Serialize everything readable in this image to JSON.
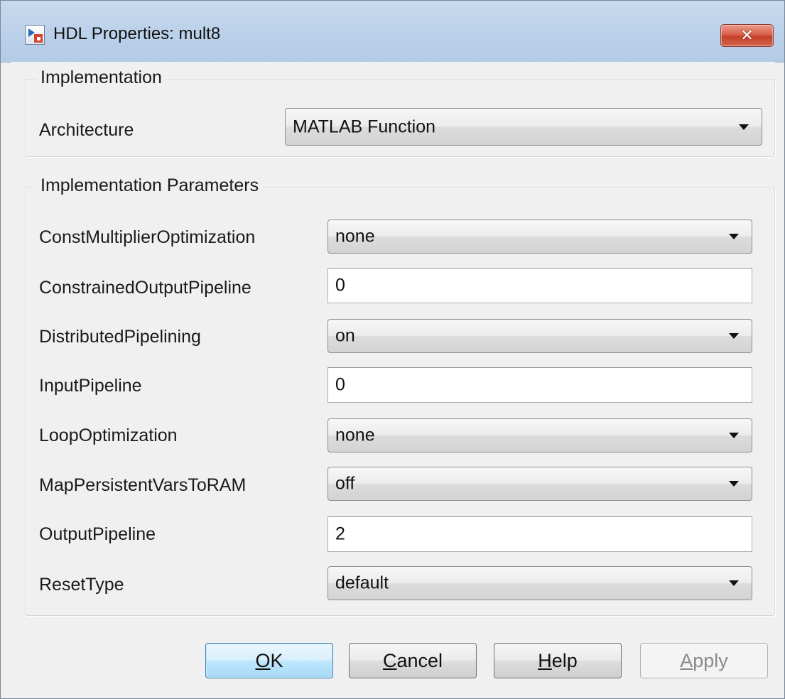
{
  "window": {
    "title": "HDL Properties: mult8",
    "close_label": "✕"
  },
  "implementation": {
    "legend": "Implementation",
    "architecture_label": "Architecture",
    "architecture_value": "MATLAB Function"
  },
  "parameters": {
    "legend": "Implementation Parameters",
    "rows": [
      {
        "label": "ConstMultiplierOptimization",
        "value": "none",
        "kind": "dropdown"
      },
      {
        "label": "ConstrainedOutputPipeline",
        "value": "0",
        "kind": "text"
      },
      {
        "label": "DistributedPipelining",
        "value": "on",
        "kind": "dropdown"
      },
      {
        "label": "InputPipeline",
        "value": "0",
        "kind": "text"
      },
      {
        "label": "LoopOptimization",
        "value": "none",
        "kind": "dropdown"
      },
      {
        "label": "MapPersistentVarsToRAM",
        "value": "off",
        "kind": "dropdown"
      },
      {
        "label": "OutputPipeline",
        "value": "2",
        "kind": "text"
      },
      {
        "label": "ResetType",
        "value": "default",
        "kind": "dropdown"
      }
    ]
  },
  "buttons": {
    "ok": {
      "mnemonic": "O",
      "rest": "K"
    },
    "cancel": {
      "mnemonic": "C",
      "rest": "ancel"
    },
    "help": {
      "mnemonic": "H",
      "rest": "elp"
    },
    "apply": {
      "mnemonic": "A",
      "rest": "pply",
      "enabled": false
    }
  },
  "colors": {
    "title_bar": "#bcd1ea",
    "close_button": "#c5402a",
    "default_button": "#bee6fd",
    "background": "#f0f0f0"
  },
  "icons": {
    "app": "simulink-block-icon",
    "dropdown": "chevron-down-icon"
  }
}
